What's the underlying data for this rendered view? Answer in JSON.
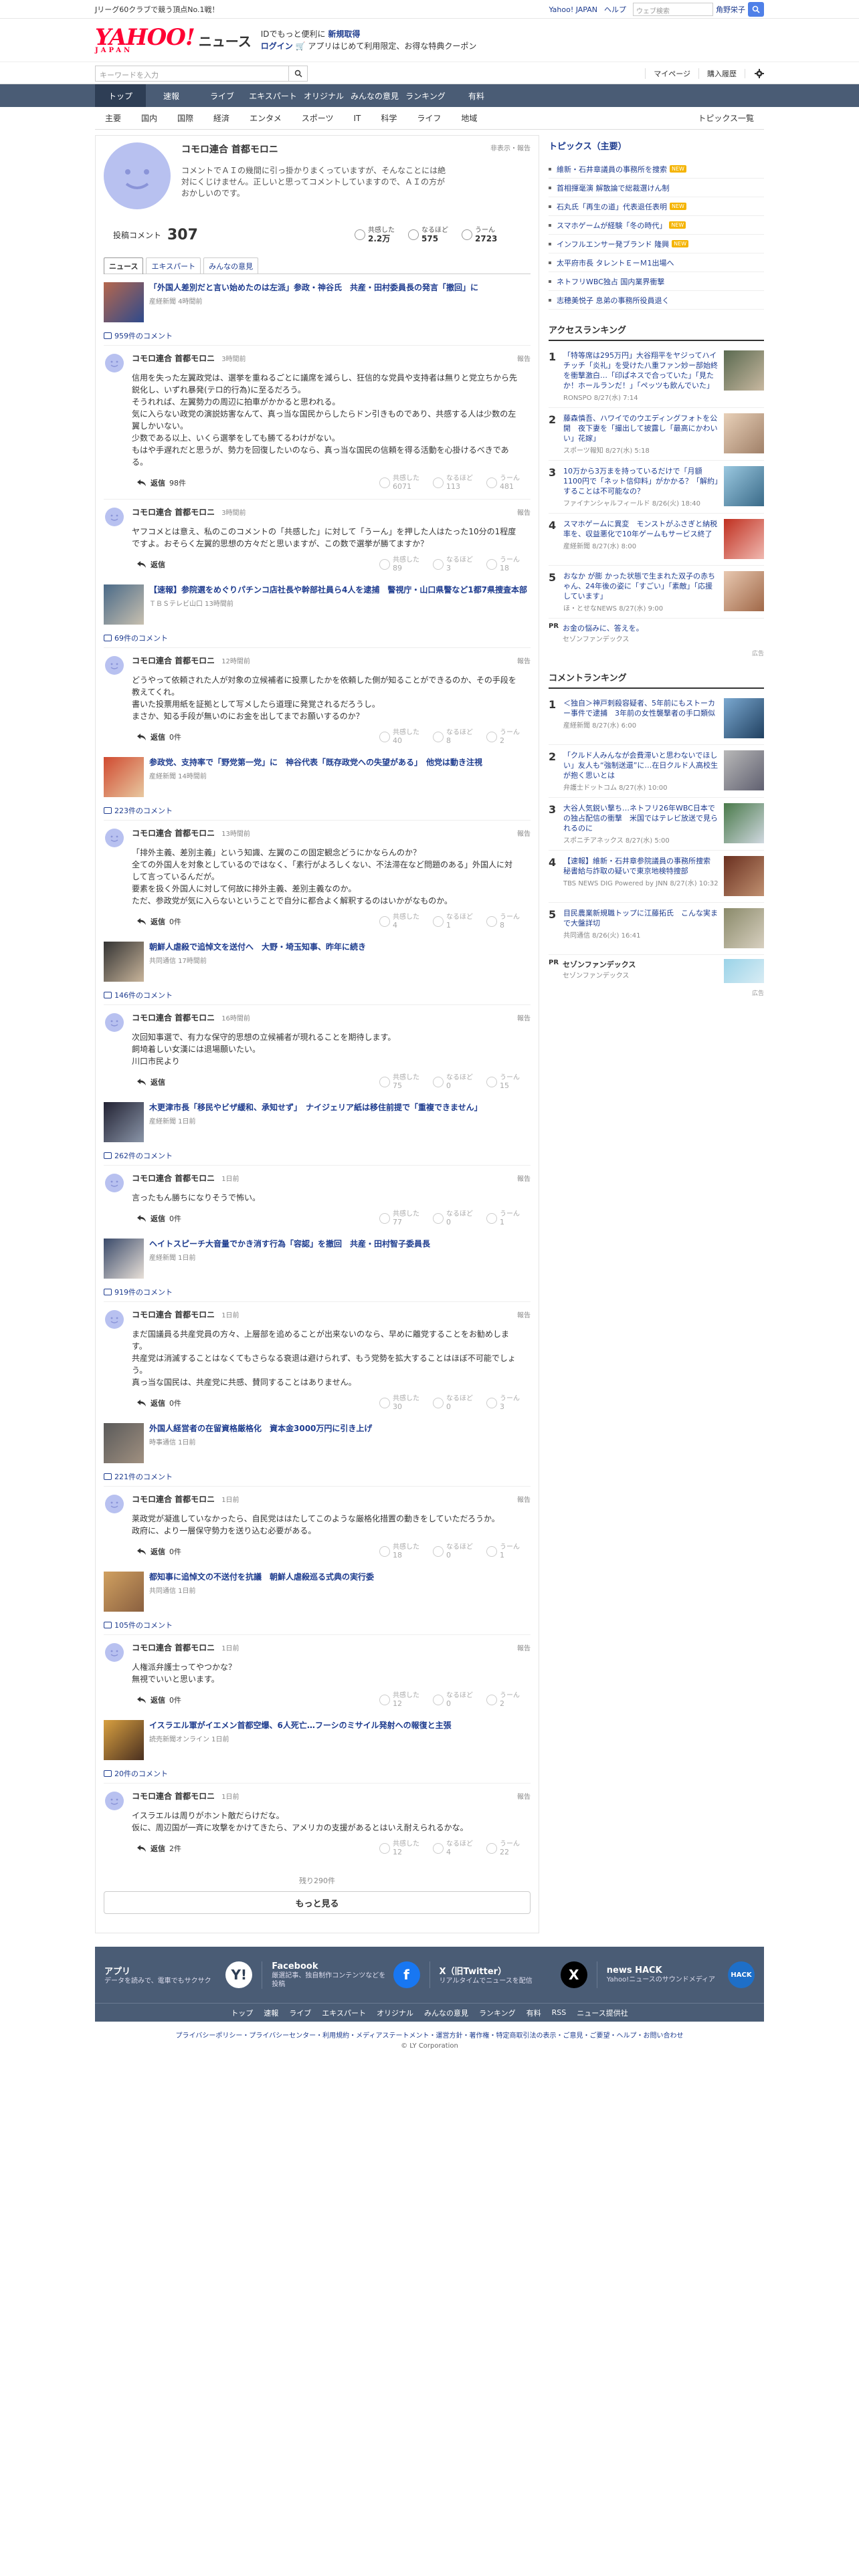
{
  "topbar": {
    "promo": "Jリーグ60クラブで競う頂点No.1戦！",
    "yahoo_japan": "Yahoo! JAPAN",
    "help": "ヘルプ",
    "search_placeholder": "ウェブ検索",
    "username": "角野栄子"
  },
  "header": {
    "logo": "YAHOO!",
    "logo_sub": "JAPAN",
    "service": "ニュース",
    "msg_line1": "IDでもっと便利に",
    "msg_new": "新規取得",
    "msg_login": "ログイン",
    "msg_line2": "アプリはじめて利用限定、お得な特典クーポン"
  },
  "search": {
    "placeholder": "キーワードを入力",
    "mypage": "マイページ",
    "history": "購入履歴"
  },
  "gnav": [
    "トップ",
    "速報",
    "ライブ",
    "エキスパート",
    "オリジナル",
    "みんなの意見",
    "ランキング",
    "有料"
  ],
  "subnav": [
    "主要",
    "国内",
    "国際",
    "経済",
    "エンタメ",
    "スポーツ",
    "IT",
    "科学",
    "ライフ",
    "地域"
  ],
  "subnav_right": "トピックス一覧",
  "profile": {
    "name": "コモロ連合 首都モロニ",
    "report": "非表示・報告",
    "bio": "コメントでＡＩの幾間に引っ掛かりまくっていますが、そんなことには絶対にくじけません。正しいと思ってコメントしていますので、ＡＩの方がおかしいのです。",
    "posts_label": "投稿コメント",
    "posts": "307",
    "stats": [
      {
        "label": "共感した",
        "value": "2.2万"
      },
      {
        "label": "なるほど",
        "value": "575"
      },
      {
        "label": "うーん",
        "value": "2723"
      }
    ],
    "tabs": [
      "ニュース",
      "エキスパート",
      "みんなの意見"
    ]
  },
  "reaction_labels": [
    "共感した",
    "なるほど",
    "うーん"
  ],
  "reply_label": "返信",
  "report_label": "報告",
  "articles": [
    {
      "title": "「外国人差別だと言い始めたのは左派」参政・神谷氏　共産・田村委員長の発言「撤回」に",
      "source": "産経新聞 4時間前",
      "count": "959件のコメント",
      "comments": [
        {
          "name": "コモロ連合 首都モロニ",
          "time": "3時間前",
          "text": "信用を失った左翼政党は、選挙を重ねるごとに議席を減らし、狂信的な党員や支持者は無りと党立ちから先鋭化し、いずれ暴発(テロ的行為)に至るだろう。\nそうれれば、左翼勢力の周辺に拍車がかかると思われる。\n気に入らない政党の演説妨害なんて、真っ当な国民からしたらドン引きものであり、共感する人は少数の左翼しかいない。\n少数である以上、いくら選挙をしても勝てるわけがない。\nもはや手遅れだと思うが、勢力を回復したいのなら、真っ当な国民の信頼を得る活動を心掛けるべきである。",
          "replies": "98件",
          "reacts": [
            "6071",
            "113",
            "481"
          ]
        },
        {
          "name": "コモロ連合 首都モロニ",
          "time": "3時間前",
          "text": "ヤフコメとは意え、私のこのコメントの「共感した」に対して「うーん」を押した人はたった10分の1程度ですよ。おそらく左翼的思想の方々だと思いますが、この数で選挙が勝てますか？",
          "replies": "",
          "reacts": [
            "89",
            "3",
            "18"
          ]
        }
      ]
    },
    {
      "title": "【速報】参院選をめぐりパチンコ店社長や幹部社員ら4人を逮捕　警視庁・山口県警など1都7県捜査本部",
      "source": "ＴＢＳテレビ山口 13時間前",
      "count": "69件のコメント",
      "comments": [
        {
          "name": "コモロ連合 首都モロニ",
          "time": "12時間前",
          "text": "どうやって依頼された人が対象の立候補者に投票したかを依頼した側が知ることができるのか、その手段を教えてくれ。\n書いた投票用紙を証拠として写メしたら道理に発覚されるだろうし。\nまさか、知る手段が無いのにお金を出してまでお願いするのか？",
          "replies": "0件",
          "reacts": [
            "40",
            "8",
            "2"
          ]
        }
      ]
    },
    {
      "title": "参政党、支持率で「野党第一党」に　神谷代表「既存政党への失望がある」　他党は動き注視",
      "source": "産経新聞 14時間前",
      "count": "223件のコメント",
      "comments": [
        {
          "name": "コモロ連合 首都モロニ",
          "time": "13時間前",
          "text": "「排外主義、差別主義」という知識、左翼のこの固定観念どうにかならんのか？\n全ての外国人を対象としているのではなく、「素行がよろしくない、不法滞在など問題のある」外国人に対して言っているんだが。\n要素を扱く外国人に対して何故に排外主義、差別主義なのか。\nただ、参政党が気に入らないということで自分に都合よく解釈するのはいかがなものか。",
          "replies": "0件",
          "reacts": [
            "4",
            "1",
            "8"
          ]
        }
      ]
    },
    {
      "title": "朝鮮人虐殺で追悼文を送付へ　大野・埼玉知事、昨年に続き",
      "source": "共同通信 17時間前",
      "count": "146件のコメント",
      "comments": [
        {
          "name": "コモロ連合 首都モロニ",
          "time": "16時間前",
          "text": "次回知事選で、有力な保守的思想の立候補者が現れることを期待します。\n飼埼着しい女漢には退場願いたい。\n川口市民より",
          "replies": "",
          "reacts": [
            "75",
            "0",
            "15"
          ]
        }
      ]
    },
    {
      "title": "木更津市長「移民やビザ緩和、承知せず」　ナイジェリア紙は移住前提で「重複できません」",
      "source": "産経新聞 1日前",
      "count": "262件のコメント",
      "comments": [
        {
          "name": "コモロ連合 首都モロニ",
          "time": "1日前",
          "text": "言ったもん勝ちになりそうで怖い。",
          "replies": "0件",
          "reacts": [
            "77",
            "0",
            "1"
          ]
        }
      ]
    },
    {
      "title": "ヘイトスピーチ大音量でかき消す行為「容認」を撤回　共産・田村智子委員長",
      "source": "産経新聞 1日前",
      "count": "919件のコメント",
      "comments": [
        {
          "name": "コモロ連合 首都モロニ",
          "time": "1日前",
          "text": "まだ国議員る共産党員の方々、上層部を追めることが出来ないのなら、早めに離党することをお勧めします。\n共産党は消滅することはなくてもさらなる衰退は避けられず、もう党勢を拡大することはほぼ不可能でしょう。\n真っ当な国民は、共産党に共感、賛同することはありません。",
          "replies": "0件",
          "reacts": [
            "30",
            "0",
            "3"
          ]
        }
      ]
    },
    {
      "title": "外国人経営者の在留資格厳格化　資本金3000万円に引き上げ",
      "source": "時事通信 1日前",
      "count": "221件のコメント",
      "comments": [
        {
          "name": "コモロ連合 首都モロニ",
          "time": "1日前",
          "text": "莱政党が凝進していなかったら、自民党ははたしてこのような厳格化措置の動きをしていただろうか。\n政府に、より一層保守勢力を送り込む必要がある。",
          "replies": "0件",
          "reacts": [
            "18",
            "0",
            "1"
          ]
        }
      ]
    },
    {
      "title": "都知事に追悼文の不送付を抗議　朝鮮人虐殺巡る式典の実行委",
      "source": "共同通信 1日前",
      "count": "105件のコメント",
      "comments": [
        {
          "name": "コモロ連合 首都モロニ",
          "time": "1日前",
          "text": "人権派弁護士ってやつかな？\n無視でいいと思います。",
          "replies": "0件",
          "reacts": [
            "12",
            "0",
            "2"
          ]
        }
      ]
    },
    {
      "title": "イスラエル軍がイエメン首都空爆、6人死亡…フーシのミサイル発射への報復と主張",
      "source": "読売新聞オンライン 1日前",
      "count": "20件のコメント",
      "comments": [
        {
          "name": "コモロ連合 首都モロニ",
          "time": "1日前",
          "text": "イスラエルは周りがホント敵だらけだな。\n仮に、周辺国が一斉に攻撃をかけてきたら、アメリカの支援があるとはいえ耐えられるかな。",
          "replies": "2件",
          "reacts": [
            "12",
            "4",
            "22"
          ]
        }
      ]
    }
  ],
  "more": {
    "remaining": "残り290件",
    "button": "もっと見る"
  },
  "side": {
    "topics_title": "トピックス（主要）",
    "topics": [
      {
        "text": "維新・石井章議員の事務所を捜索",
        "badge": "NEW"
      },
      {
        "text": "首相揮毫演 解散論で総裁選けん制",
        "badge": ""
      },
      {
        "text": "石丸氏「再生の道」代表退任表明",
        "badge": "NEW"
      },
      {
        "text": "スマホゲームが経験「冬の時代」",
        "badge": "NEW"
      },
      {
        "text": "インフルエンサー発ブランド 隆興",
        "badge": "NEW"
      },
      {
        "text": "太平府市長 タレントＥーＭ1出場へ",
        "badge": ""
      },
      {
        "text": "ネトフリWBC独占 国内業界衝撃",
        "badge": ""
      },
      {
        "text": "志穂美悦子 息弟の事務所役員退く",
        "badge": ""
      }
    ],
    "access_title": "アクセスランキング",
    "access": [
      {
        "n": "1",
        "title": "「特等席は295万円」大谷翔平をヤジってハイチッチ「炎礼」を受けた八重ファン妙ー部始終を衝撃激白…「印ぱネスで合っていた」「見たか！ホールランだ！」「ペッツも飲んでいた」",
        "src": "RONSPO 8/27(水) 7:14"
      },
      {
        "n": "2",
        "title": "藤森慎吾、ハワイでのウエディングフォトを公開　夜下妻を「撮出して披露し「最高にかわいい」花嫁」",
        "src": "スポーツ報知 8/27(水) 5:18"
      },
      {
        "n": "3",
        "title": "10万から3万まを持っているだけで「月額1100円で「ネット信仰料」がかかる？「解約」することは不可能なの？",
        "src": "ファイナンシャルフィールド 8/26(火) 18:40"
      },
      {
        "n": "4",
        "title": "スマホゲームに異変　モンストがふさぎと納税率を、収益悪化で10年ゲームもサービス終了",
        "src": "産経新聞 8/27(水) 8:00"
      },
      {
        "n": "5",
        "title": "おなか が膨 かった状態で生まれた双子の赤ちゃん、24年後の姿に「すごい」「素敵」「応援しています」",
        "src": "ほ・とせなNEWS 8/27(水) 9:00"
      }
    ],
    "pr1": {
      "tag": "PR",
      "title": "お金の悩みに、答えを。",
      "sub": "セゾンファンデックス"
    },
    "comment_title": "コメントランキング",
    "comments": [
      {
        "n": "1",
        "title": "＜独自＞神戸刺殺容疑者、5年前にもストーカー事件で逮捕　3年前の女性襲撃者の手口類似",
        "src": "産経新聞 8/27(水) 6:00"
      },
      {
        "n": "2",
        "title": "「クルド人みんなが会費滞いと思わないでほしい」友人も“強制送還”に…在日クルド人高校生が抱く思いとは",
        "src": "弁護士ドットコム 8/27(水) 10:00"
      },
      {
        "n": "3",
        "title": "大谷人気鋭い撃ち…ネトフリ26年WBC日本での独占配信の衝撃　米国ではテレビ放送で見られるのに",
        "src": "スポニチアネックス 8/27(水) 5:00"
      },
      {
        "n": "4",
        "title": "【速報】維新・石井章参院議員の事務所捜索 秘書給与詐取の疑いで東京地検特捜部",
        "src": "TBS NEWS DIG Powered by JNN 8/27(水) 10:32"
      },
      {
        "n": "5",
        "title": "目民農業新規職トップに江藤拓氏　こんな実まで大盤詳切",
        "src": "共同通信 8/26(火) 16:41"
      }
    ],
    "pr2": {
      "tag": "PR",
      "title": "セゾンファンデックス",
      "sub": "セゾンファンデックス"
    },
    "ad_note": "広告"
  },
  "footer": {
    "cells": [
      {
        "title": "アプリ",
        "desc": "データを読みで、電車でもサクサク"
      },
      {
        "title": "Facebook",
        "desc": "厳選記事、独自制作コンテンツなどを投稿"
      },
      {
        "title": "X（旧Twitter）",
        "desc": "リアルタイムでニュースを配信"
      },
      {
        "title": "news HACK",
        "desc": "Yahoo!ニュースのサウンドメディア"
      }
    ],
    "links": [
      "トップ",
      "速報",
      "ライブ",
      "エキスパート",
      "オリジナル",
      "みんなの意見",
      "ランキング",
      "有料",
      "RSS",
      "ニュース提供社"
    ],
    "legal": "プライバシーポリシー・プライバシーセンター・利用規約・メディアステートメント・運営方針・著作権・特定商取引法の表示・ご意見・ご要望・ヘルプ・お問い合わせ",
    "copyright": "© LY Corporation"
  }
}
